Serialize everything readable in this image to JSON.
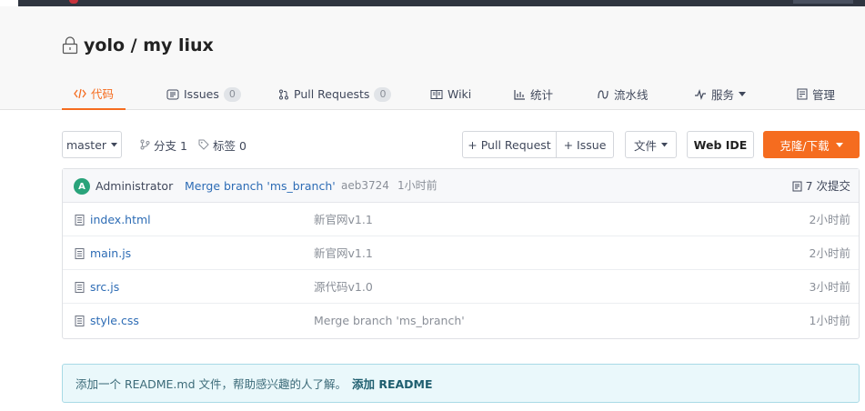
{
  "repo": {
    "owner": "yolo",
    "separator": " / ",
    "name": "my liux"
  },
  "tabs": [
    {
      "label": "代码",
      "icon": "code-icon"
    },
    {
      "label": "Issues",
      "count": "0",
      "icon": "issues-icon"
    },
    {
      "label": "Pull Requests",
      "count": "0",
      "icon": "pull-request-icon"
    },
    {
      "label": "Wiki",
      "icon": "wiki-icon"
    },
    {
      "label": "统计",
      "icon": "stats-icon"
    },
    {
      "label": "流水线",
      "icon": "pipeline-icon"
    },
    {
      "label": "服务",
      "icon": "service-icon"
    },
    {
      "label": "管理",
      "icon": "manage-icon"
    }
  ],
  "toolbar": {
    "branch": "master",
    "branches_label": "分支 1",
    "tags_label": "标签 0",
    "pull_request_btn": "+ Pull Request",
    "issue_btn": "+ Issue",
    "file_btn": "文件",
    "web_ide_btn": "Web IDE",
    "clone_btn": "克隆/下载"
  },
  "last_commit": {
    "avatar_letter": "A",
    "author": "Administrator",
    "message": "Merge branch 'ms_branch'",
    "sha": "aeb3724",
    "time": "1小时前",
    "count_label": "7 次提交"
  },
  "files": [
    {
      "name": "index.html",
      "message": "新官网v1.1",
      "time": "2小时前"
    },
    {
      "name": "main.js",
      "message": "新官网v1.1",
      "time": "2小时前"
    },
    {
      "name": "src.js",
      "message": "源代码v1.0",
      "time": "3小时前"
    },
    {
      "name": "style.css",
      "message": "Merge branch 'ms_branch'",
      "time": "1小时前"
    }
  ],
  "readme": {
    "text": "添加一个 README.md 文件，帮助感兴趣的人了解。",
    "link": "添加 README"
  },
  "colors": {
    "accent": "#f56c1f",
    "link": "#2d6cb5",
    "avatar": "#29a37a",
    "info_bg": "#eaf8fb"
  }
}
